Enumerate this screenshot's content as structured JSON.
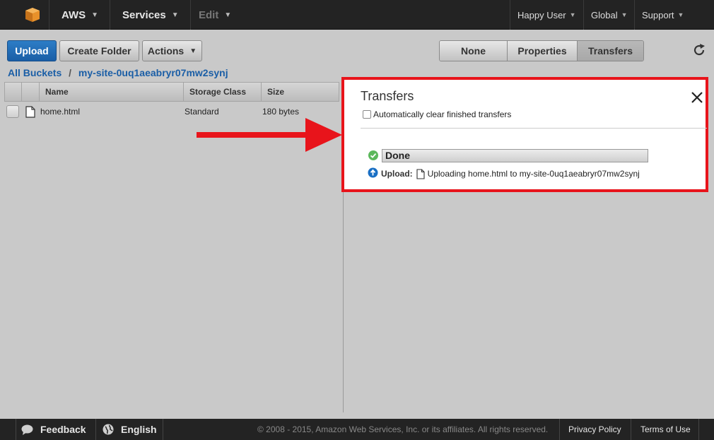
{
  "topbar": {
    "aws_label": "AWS",
    "services_label": "Services",
    "edit_label": "Edit",
    "user_label": "Happy User",
    "region_label": "Global",
    "support_label": "Support"
  },
  "toolbar": {
    "upload_label": "Upload",
    "create_folder_label": "Create Folder",
    "actions_label": "Actions",
    "view_tabs": [
      "None",
      "Properties",
      "Transfers"
    ]
  },
  "breadcrumb": {
    "root": "All Buckets",
    "separator": "/",
    "bucket": "my-site-0uq1aeabryr07mw2synj"
  },
  "table": {
    "columns": [
      "Name",
      "Storage Class",
      "Size"
    ],
    "rows": [
      {
        "name": "home.html",
        "storage_class": "Standard",
        "size": "180 bytes"
      }
    ]
  },
  "transfers": {
    "title": "Transfers",
    "auto_clear_label": "Automatically clear finished transfers",
    "auto_clear_checked": false,
    "status": "Done",
    "progress": 1.0,
    "upload_label": "Upload:",
    "upload_text": "Uploading home.html to my-site-0uq1aeabryr07mw2synj"
  },
  "footer": {
    "feedback_label": "Feedback",
    "language_label": "English",
    "copyright": "© 2008 - 2015, Amazon Web Services, Inc. or its affiliates. All rights reserved.",
    "privacy_label": "Privacy Policy",
    "terms_label": "Terms of Use"
  },
  "colors": {
    "primary_blue": "#1a5ea6",
    "highlight_red": "#e8141b",
    "success_green": "#5cb85c",
    "topbar_bg": "#232323"
  }
}
